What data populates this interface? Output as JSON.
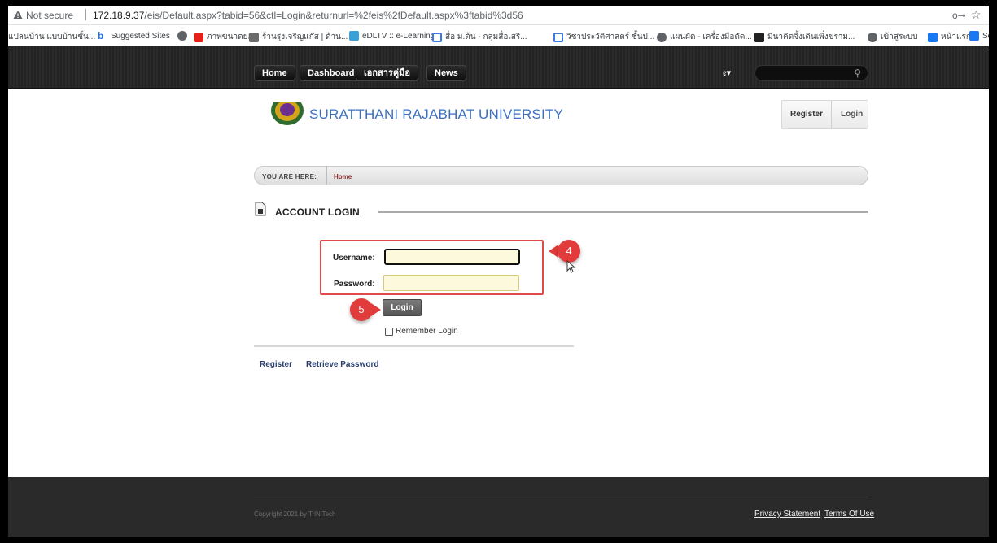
{
  "browser": {
    "security_label": "Not secure",
    "url_host": "172.18.9.37",
    "url_path": "/eis/Default.aspx?tabid=56&ctl=Login&returnurl=%2feis%2fDefault.aspx%3ftabid%3d56"
  },
  "bookmarks": [
    {
      "label": "แปลนบ้าน แบบบ้านชั้น...",
      "color": "#e8e8e8"
    },
    {
      "label": "Suggested Sites",
      "color": "#1a73e8"
    },
    {
      "label": "",
      "color": "#5f6368"
    },
    {
      "label": "ภาพขนาดย่อ",
      "color": "#e62117"
    },
    {
      "label": "ร้านรุ่งเจริญแก๊ส | ด้าน...",
      "color": "#6b6b6b"
    },
    {
      "label": "eDLTV :: e-Learning...",
      "color": "#3aa0d8"
    },
    {
      "label": "สื่อ ม.ต้น - กลุ่มสื่อเสริ...",
      "color": "#3b78e7"
    },
    {
      "label": "วิชาประวัติศาสตร์ ชั้นป...",
      "color": "#3b78e7"
    },
    {
      "label": "แผนผัด - เครื่องมือตัด...",
      "color": "#5f6368"
    },
    {
      "label": "มีนาคิดจิ้งเดินเพิ่งขราม...",
      "color": "#222222"
    },
    {
      "label": "เข้าสู่ระบบ",
      "color": "#5f6368"
    },
    {
      "label": "หน้าแรก",
      "color": "#1877f2"
    },
    {
      "label": "Sora",
      "color": "#1877f2"
    }
  ],
  "nav": {
    "home": "Home",
    "dashboard": "Dashboard",
    "manual": "เอกสารคู่มือ",
    "news": "News",
    "lang": "ꬲ▾"
  },
  "header": {
    "university": "SURATTHANI RAJABHAT UNIVERSITY",
    "register": "Register",
    "login": "Login"
  },
  "breadcrumb": {
    "you_are_here": "YOU ARE HERE:",
    "home": "Home"
  },
  "section": {
    "title": "ACCOUNT LOGIN"
  },
  "form": {
    "username_label": "Username:",
    "password_label": "Password:",
    "username_value": "",
    "password_value": "",
    "login_button": "Login",
    "remember_label": "Remember Login",
    "register_link": "Register",
    "retrieve_link": "Retrieve Password"
  },
  "annotations": {
    "step4": "4",
    "step5": "5"
  },
  "footer": {
    "copyright": "Copyright 2021 by TriNiTech",
    "privacy": "Privacy Statement",
    "terms": "Terms Of Use"
  },
  "colors": {
    "annotation_red": "#e04a4a",
    "university_blue": "#3a6fc2"
  }
}
